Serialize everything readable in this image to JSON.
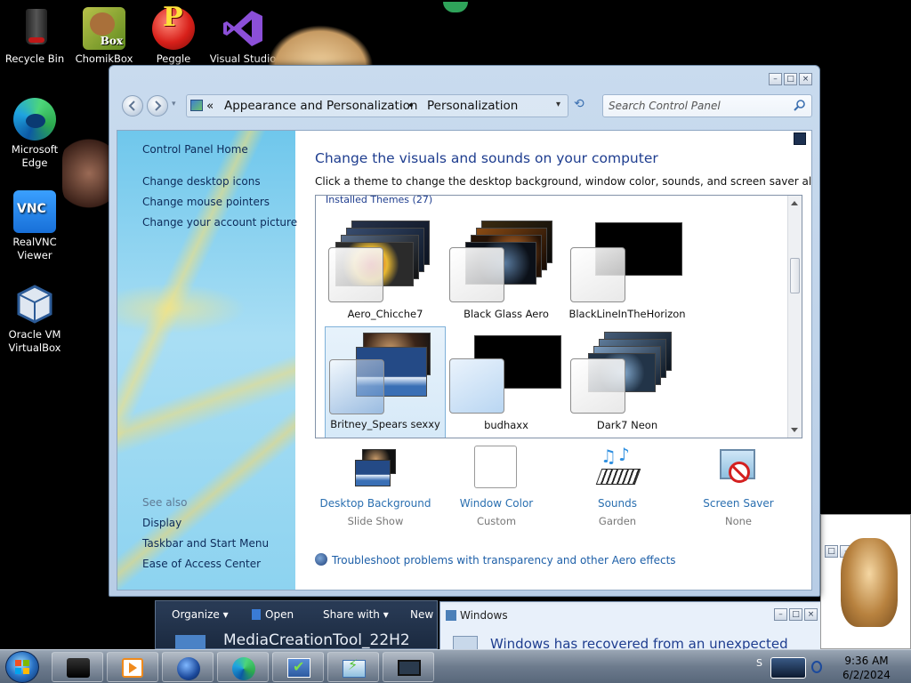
{
  "desktop": {
    "icons": [
      {
        "label": "Recycle Bin",
        "icon": "recycle-bin-icon"
      },
      {
        "label": "ChomikBox",
        "icon": "chomikbox-icon",
        "badge": "Box"
      },
      {
        "label": "Peggle Deluxe",
        "icon": "peggle-icon",
        "badge": "P"
      },
      {
        "label": "Visual Studio",
        "icon": "visual-studio-icon"
      },
      {
        "label": "Microsoft Edge",
        "icon": "edge-icon"
      },
      {
        "label": "RealVNC Viewer",
        "icon": "realvnc-icon",
        "badge": "VNC"
      },
      {
        "label": "Oracle VM VirtualBox",
        "icon": "virtualbox-icon"
      }
    ]
  },
  "window": {
    "caption_buttons": [
      "minimize-icon",
      "maximize-icon",
      "close-icon"
    ],
    "address": {
      "crumb1": "Appearance and Personalization",
      "separator": "•",
      "crumb2": "Personalization",
      "chevron": "«"
    },
    "search_placeholder": "Search Control Panel",
    "left_pane": {
      "home": "Control Panel Home",
      "links": [
        "Change desktop icons",
        "Change mouse pointers",
        "Change your account picture"
      ],
      "see_also_title": "See also",
      "see_also": [
        "Display",
        "Taskbar and Start Menu",
        "Ease of Access Center"
      ]
    },
    "heading": "Change the visuals and sounds on your computer",
    "subheading": "Click a theme to change the desktop background, window color, sounds, and screen saver all at once.",
    "themes_header": "Installed Themes (27)",
    "themes": [
      {
        "name": "Aero_Chicche7"
      },
      {
        "name": "Black Glass Aero"
      },
      {
        "name": "BlackLineInTheHorizon"
      },
      {
        "name": "Britney_Spears sexxy",
        "selected": true
      },
      {
        "name": "budhaxx"
      },
      {
        "name": "Dark7 Neon"
      }
    ],
    "bottom": [
      {
        "label": "Desktop Background",
        "sub": "Slide Show",
        "icon": "desktop-background-icon"
      },
      {
        "label": "Window Color",
        "sub": "Custom",
        "icon": "window-color-icon"
      },
      {
        "label": "Sounds",
        "sub": "Garden",
        "icon": "sounds-icon"
      },
      {
        "label": "Screen Saver",
        "sub": "None",
        "icon": "screen-saver-icon"
      }
    ],
    "troubleshoot": "Troubleshoot problems with transparency and other Aero effects"
  },
  "explorer": {
    "toolbar": [
      "Organize",
      "Open",
      "Share with",
      "New"
    ],
    "file_title": "MediaCreationTool_22H2"
  },
  "dialog": {
    "title": "Windows",
    "message": "Windows has recovered from an unexpected"
  },
  "taskbar": {
    "time": "9:36 AM",
    "date": "6/2/2024",
    "tray_letter": "S"
  },
  "colors": {
    "link": "#2a6fb0",
    "heading": "#1e3d8f",
    "nav_text": "#0d2b5a"
  }
}
